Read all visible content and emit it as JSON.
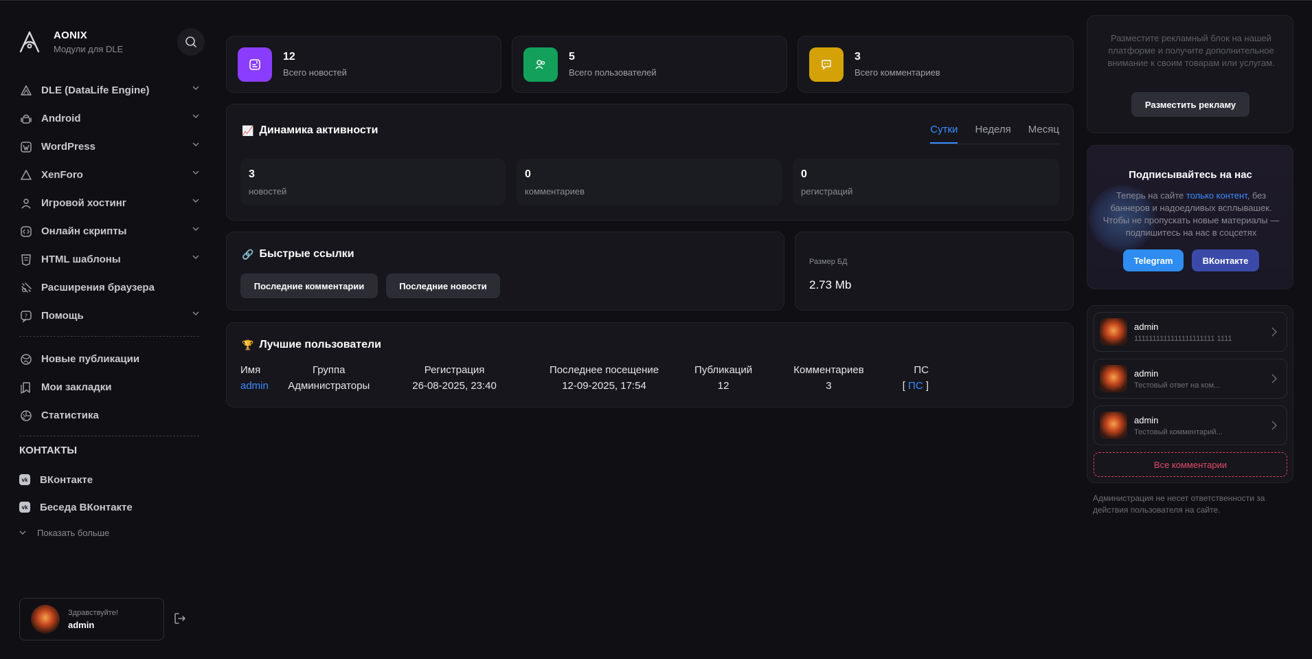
{
  "brand": {
    "title": "AONIX",
    "subtitle": "Модули для DLE"
  },
  "nav": [
    {
      "label": "DLE (DataLife Engine)",
      "icon": "triangle-icon",
      "expandable": true
    },
    {
      "label": "Android",
      "icon": "android-icon",
      "expandable": true
    },
    {
      "label": "WordPress",
      "icon": "wordpress-icon",
      "expandable": true
    },
    {
      "label": "XenForo",
      "icon": "xenforo-icon",
      "expandable": true
    },
    {
      "label": "Игровой хостинг",
      "icon": "user-icon",
      "expandable": true
    },
    {
      "label": "Онлайн скрипты",
      "icon": "code-icon",
      "expandable": true
    },
    {
      "label": "HTML шаблоны",
      "icon": "html-icon",
      "expandable": true
    },
    {
      "label": "Расширения браузера",
      "icon": "puzzle-icon",
      "expandable": false
    },
    {
      "label": "Помощь",
      "icon": "help-icon",
      "expandable": true
    }
  ],
  "nav2": [
    {
      "label": "Новые публикации",
      "icon": "globe-icon"
    },
    {
      "label": "Мои закладки",
      "icon": "bookmark-icon"
    },
    {
      "label": "Статистика",
      "icon": "chart-icon"
    }
  ],
  "contacts": {
    "heading": "КОНТАКТЫ",
    "items": [
      {
        "label": "ВКонтакте",
        "icon": "vk-icon"
      },
      {
        "label": "Беседа ВКонтакте",
        "icon": "vk-icon"
      }
    ],
    "more": "Показать больше"
  },
  "user": {
    "greeting": "Здравствуйте!",
    "name": "admin"
  },
  "stats": [
    {
      "value": "12",
      "label": "Всего новостей",
      "color": "#8b3dff"
    },
    {
      "value": "5",
      "label": "Всего пользователей",
      "color": "#12a05a"
    },
    {
      "value": "3",
      "label": "Всего комментариев",
      "color": "#d4a106"
    }
  ],
  "activity": {
    "emoji": "📈",
    "title": "Динамика активности",
    "tabs": [
      "Сутки",
      "Неделя",
      "Месяц"
    ],
    "active_tab": 0,
    "items": [
      {
        "value": "3",
        "label": "новостей"
      },
      {
        "value": "0",
        "label": "комментариев"
      },
      {
        "value": "0",
        "label": "регистраций"
      }
    ]
  },
  "quick_links": {
    "emoji": "🔗",
    "title": "Быстрые ссылки",
    "buttons": [
      "Последние комментарии",
      "Последние новости"
    ]
  },
  "db": {
    "label": "Размер БД",
    "value": "2.73 Mb"
  },
  "top_users": {
    "emoji": "🏆",
    "title": "Лучшие пользователи",
    "columns": [
      "Имя",
      "Группа",
      "Регистрация",
      "Последнее посещение",
      "Публикаций",
      "Комментариев",
      "ПС"
    ],
    "rows": [
      {
        "name": "admin",
        "group": "Администраторы",
        "reg": "26-08-2025, 23:40",
        "last": "12-09-2025, 17:54",
        "pubs": "12",
        "comments": "3",
        "pm": "ПС",
        "pm_open": "[",
        "pm_close": "]"
      }
    ]
  },
  "ad": {
    "text": "Разместите рекламный блок на нашей платформе и получите дополнительное внимание к своим товарам или услугам.",
    "button": "Разместить рекламу"
  },
  "subscribe": {
    "title": "Подписывайтесь на нас",
    "text_before": "Теперь на сайте ",
    "text_link": "только контент",
    "text_after": ", без баннеров и надоедливых всплывашек. Чтобы не пропускать новые материалы — подпишитесь на нас в соцсетях",
    "telegram": "Telegram",
    "vk": "ВКонтакте"
  },
  "comments": [
    {
      "name": "admin",
      "text": "1111111111111111111111 1111"
    },
    {
      "name": "admin",
      "text": "Тестовый ответ на ком..."
    },
    {
      "name": "admin",
      "text": "Тестовый комментарий..."
    }
  ],
  "all_comments": "Все комментарии",
  "disclaimer": "Администрация не несет ответственности за действия пользователя на сайте."
}
